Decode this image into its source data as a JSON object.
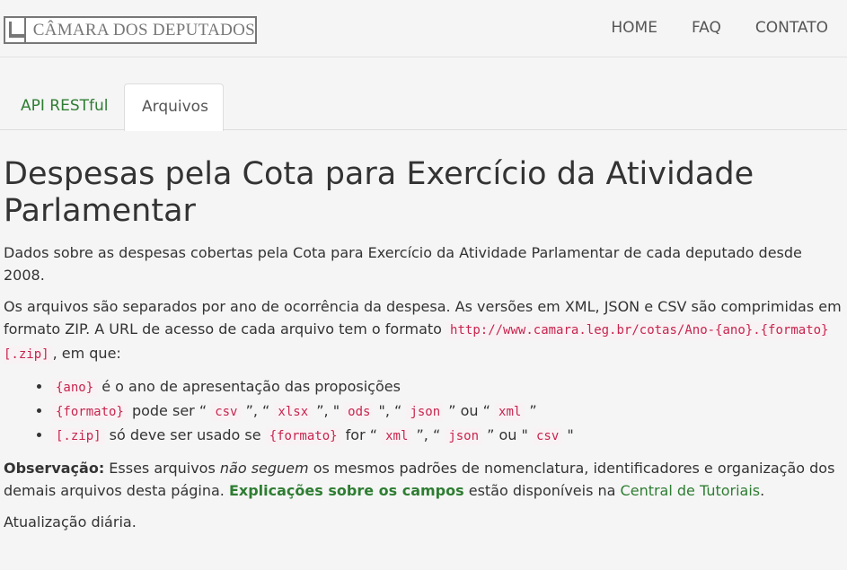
{
  "header": {
    "logo_text": "CÂMARA DOS DEPUTADOS",
    "nav": [
      "HOME",
      "FAQ",
      "CONTATO"
    ]
  },
  "tabs": [
    "API RESTful",
    "Arquivos"
  ],
  "main": {
    "title": "Despesas pela Cota para Exercício da Atividade Parlamentar",
    "intro": "Dados sobre as despesas cobertas pela Cota para Exercício da Atividade Parlamentar de cada deputado desde 2008.",
    "p2_text": "Os arquivos são separados por ano de ocorrência da despesa. As versões em XML, JSON e CSV são comprimidas em formato ZIP. A URL de acesso de cada arquivo tem o formato ",
    "p2_url": "http://www.camara.leg.br/cotas/Ano-{ano}.{formato}[.zip]",
    "p2_end": ", em que:",
    "list": {
      "i1_code": "{ano}",
      "i1_text": " é o ano de apresentação das proposições",
      "i2_code": "{formato}",
      "i2_t1": " pode ser “ ",
      "i2_c1": "csv",
      "i2_t2": " ”, “ ",
      "i2_c2": "xlsx",
      "i2_t3": " ”, \" ",
      "i2_c3": "ods",
      "i2_t4": " \", “ ",
      "i2_c4": "json",
      "i2_t5": " ” ou “ ",
      "i2_c5": "xml",
      "i2_t6": " ”",
      "i3_code": "[.zip]",
      "i3_t1": " só deve ser usado se ",
      "i3_c1": "{formato}",
      "i3_t2": " for “ ",
      "i3_c2": "xml",
      "i3_t3": " ”, “ ",
      "i3_c3": "json",
      "i3_t4": " ” ou \" ",
      "i3_c4": "csv",
      "i3_t5": " \""
    },
    "obs_label": "Observação:",
    "obs_t1": " Esses arquivos ",
    "obs_em": "não seguem",
    "obs_t2": " os mesmos padrões de nomenclatura, identificadores e organização dos demais arquivos desta página. ",
    "obs_bold_link": "Explicações sobre os campos",
    "obs_t3": " estão disponíveis na ",
    "obs_link": "Central de Tutoriais",
    "obs_t4": ".",
    "update": "Atualização diária."
  },
  "colors": {
    "accent": "#2e7d32",
    "code": "#c7254e"
  }
}
